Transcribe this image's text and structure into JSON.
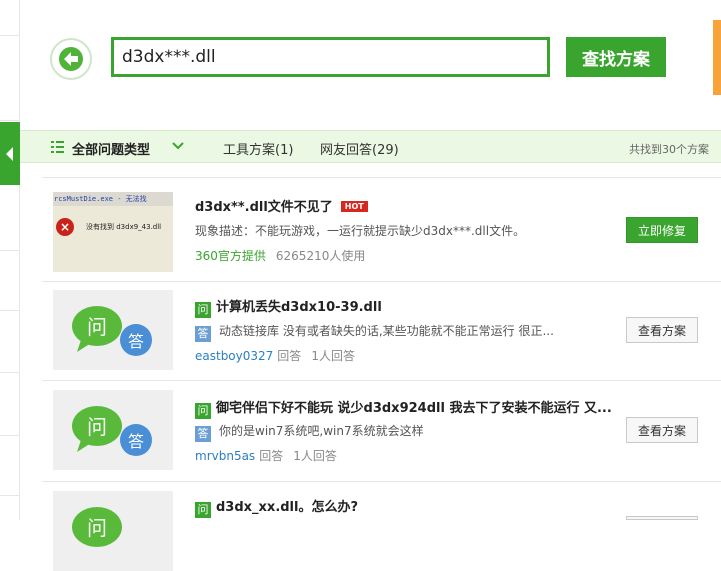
{
  "search": {
    "value": "d3dx***.dll",
    "button_label": "查找方案"
  },
  "filter": {
    "all_types": "全部问题类型",
    "tool_tab": "工具方案(1)",
    "user_tab": "网友回答(29)",
    "found": "共找到30个方案"
  },
  "results": [
    {
      "thumb_title": "rcsMustDie.exe - 无法找",
      "thumb_msg": "没有找到 d3dx9_43.dll",
      "title": "d3dx**.dll文件不见了",
      "hot": "HOT",
      "desc": "现象描述：不能玩游戏，一运行就提示缺少d3dx***.dll文件。",
      "source": "360官方提供",
      "users": "6265210人使用",
      "button": "立即修复"
    },
    {
      "q_badge": "问",
      "a_badge": "答",
      "title": "计算机丢失d3dx10-39.dll",
      "desc": "动态链接库   没有或者缺失的话,某些功能就不能正常运行    很正...",
      "user": "eastboy0327",
      "answer": "回答",
      "count": "1人回答",
      "button": "查看方案"
    },
    {
      "q_badge": "问",
      "a_badge": "答",
      "title": "御宅伴侣下好不能玩 说少d3dx924dll 我去下了安装不能运行 又...",
      "desc": "你的是win7系统吧,win7系统就会这样",
      "user": "mrvbn5as",
      "answer": "回答",
      "count": "1人回答",
      "button": "查看方案"
    },
    {
      "q_badge": "问",
      "title": "d3dx_xx.dll。怎么办?"
    }
  ],
  "bubble": {
    "q": "问",
    "a": "答"
  },
  "colors": {
    "accent": "#3aa52e",
    "hot": "#d6281e",
    "answer_badge": "#6b9fd4",
    "orange": "#f7a33a"
  }
}
